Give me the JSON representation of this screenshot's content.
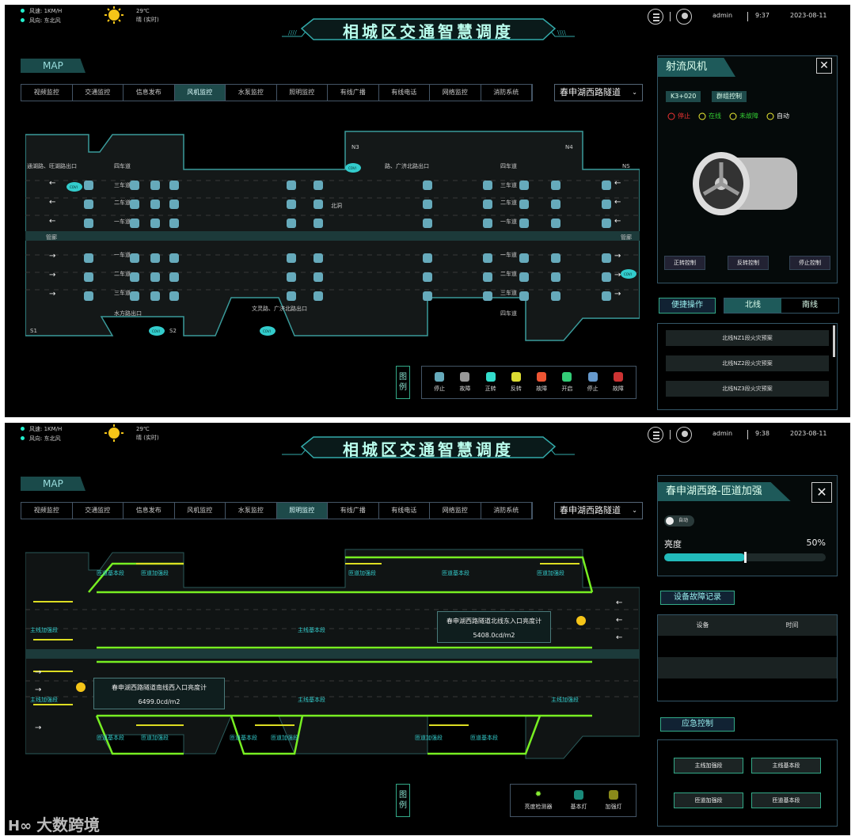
{
  "top": {
    "wind_speed": "风速: 1KM/H",
    "wind_dir": "风向: 东北风",
    "temp": "29℃",
    "weather": "晴 (实时)",
    "title": "相城区交通智慧调度",
    "user": "admin",
    "date": "2023-08-11"
  },
  "screen1": {
    "time": "9:37"
  },
  "screen2": {
    "time": "9:38"
  },
  "map_label": "MAP",
  "tabs": [
    "视频监控",
    "交通监控",
    "信息发布",
    "风机监控",
    "水泵监控",
    "照明监控",
    "有线广播",
    "有线电话",
    "网络监控",
    "消防系统"
  ],
  "tunnel_select": "春申湖西路隧道",
  "map1": {
    "texts": {
      "n3": "N3",
      "n4": "N4",
      "ns": "NS",
      "exit_w": "通湖路、旺湖路出口",
      "exit_n": "路、广济北路出口",
      "exit_s1": "水方路出口",
      "exit_s2": "文灵路、广济北路出口",
      "s1": "S1",
      "s2": "S2",
      "lane4": "四车道",
      "lane3": "三车道",
      "lane2": "二车道",
      "lane1": "一车道",
      "north": "北洞",
      "guan": "管廊",
      "covi": "COVI"
    }
  },
  "legend1": {
    "label": "图例",
    "items": [
      {
        "name": "停止",
        "color": "#6ab"
      },
      {
        "name": "故障",
        "color": "#999"
      },
      {
        "name": "正转",
        "color": "#3dc"
      },
      {
        "name": "反转",
        "color": "#dd3"
      },
      {
        "name": "故障",
        "color": "#e53"
      },
      {
        "name": "开启",
        "color": "#3c7"
      },
      {
        "name": "停止",
        "color": "#69c"
      },
      {
        "name": "故障",
        "color": "#c33"
      }
    ]
  },
  "fan_panel": {
    "title": "射流风机",
    "pile": "K3+020",
    "group": "群组控制",
    "status": [
      {
        "name": "停止",
        "color": "#e33"
      },
      {
        "name": "在线",
        "color": "#ee3"
      },
      {
        "name": "未故障",
        "color": "#ee3"
      },
      {
        "name": "自动",
        "color": "#ee3"
      }
    ],
    "buttons": [
      "正转控制",
      "反转控制",
      "停止控制"
    ]
  },
  "quick": {
    "label": "便捷操作",
    "north": "北线",
    "south": "南线",
    "items": [
      "北线NZ1段火灾预案",
      "北线NZ2段火灾预案",
      "北线NZ3段火灾预案"
    ]
  },
  "light_panel": {
    "title": "春申湖西路-匝道加强",
    "auto": "自动",
    "brightness_label": "亮度",
    "brightness_value": "50%",
    "brightness": 0.5
  },
  "fault": {
    "label": "设备故障记录",
    "col_device": "设备",
    "col_time": "时间"
  },
  "emergency": {
    "label": "应急控制",
    "buttons": [
      "主线加强段",
      "主线基本段",
      "匝道加强段",
      "匝道基本段"
    ]
  },
  "map2": {
    "main_enh": "主线加强段",
    "main_base": "主线基本段",
    "ramp_enh": "匝道加强段",
    "ramp_base": "匝道基本段",
    "lum_east_title": "春申湖西路隧道北线东入口亮度计",
    "lum_east_val": "5408.0cd/m2",
    "lum_west_title": "春申湖西路隧道南线西入口亮度计",
    "lum_west_val": "6499.0cd/m2"
  },
  "legend2": {
    "label": "图例",
    "items": [
      {
        "name": "亮度检测器",
        "color": "#8e3"
      },
      {
        "name": "基本灯",
        "color": "#1a8a7a"
      },
      {
        "name": "加强灯",
        "color": "#8a8a1a"
      }
    ]
  },
  "watermark": "大数跨境"
}
